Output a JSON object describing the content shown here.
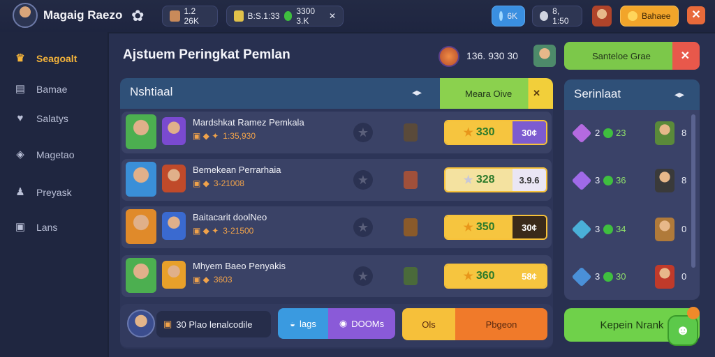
{
  "topbar": {
    "app_title": "Magaig Raezo",
    "res1": "1.2 26K",
    "res2": "B:S.1:33",
    "res3": "3300 3.K",
    "gems": "6K",
    "shield": "8, 1:50",
    "gold_btn": "Bahaee"
  },
  "sidebar": {
    "items": [
      {
        "label": "Seagoalt",
        "icon": "trophy-icon"
      },
      {
        "label": "Bamae",
        "icon": "grid-icon"
      },
      {
        "label": "Salatys",
        "icon": "heart-icon"
      },
      {
        "label": "Magetao",
        "icon": "cards-icon"
      },
      {
        "label": "Preyask",
        "icon": "person-icon"
      },
      {
        "label": "Lans",
        "icon": "box-icon"
      }
    ]
  },
  "header": {
    "title": "Ajstuem Peringkat Pemlan",
    "score": "136. 930  30",
    "green_btn": "Santeloe Grae"
  },
  "panel": {
    "title": "Nshtiaal",
    "filter": "Meara Oive"
  },
  "rows": [
    {
      "name": "Mardshkat Ramez Pemkala",
      "sub": "1:35,930",
      "score": "330",
      "pct": "30¢",
      "pct_color": "#7d5bd0"
    },
    {
      "name": "Bemekean Perrarhaia",
      "sub": "3-21008",
      "score": "328",
      "pct": "3.9.6",
      "pct_color": "#eae6f4"
    },
    {
      "name": "Baitacarit doolNeo",
      "sub": "3-21500",
      "score": "350",
      "pct": "30¢",
      "pct_color": "#3a2a1a"
    },
    {
      "name": "Mhyem Baeo Penyakis",
      "sub": "3603",
      "score": "360",
      "pct": "58¢",
      "pct_color": "#f6c53f"
    }
  ],
  "bottom": {
    "label": "30 Plao lenalcodile",
    "tab1": "lags",
    "tab2": "DOOMs",
    "orange1": "Ols",
    "orange2": "Pbgeon"
  },
  "right": {
    "title": "Serinlaat",
    "rows": [
      {
        "num": "2",
        "val": "23",
        "last": "8",
        "gem_color": "#b46ae0"
      },
      {
        "num": "3",
        "val": "36",
        "last": "8",
        "gem_color": "#a06ae8"
      },
      {
        "num": "3",
        "val": "34",
        "last": "0",
        "gem_color": "#4ab0d8"
      },
      {
        "num": "3",
        "val": "30",
        "last": "0",
        "gem_color": "#4a90d8"
      }
    ],
    "cta": "Kepein Nrank"
  }
}
